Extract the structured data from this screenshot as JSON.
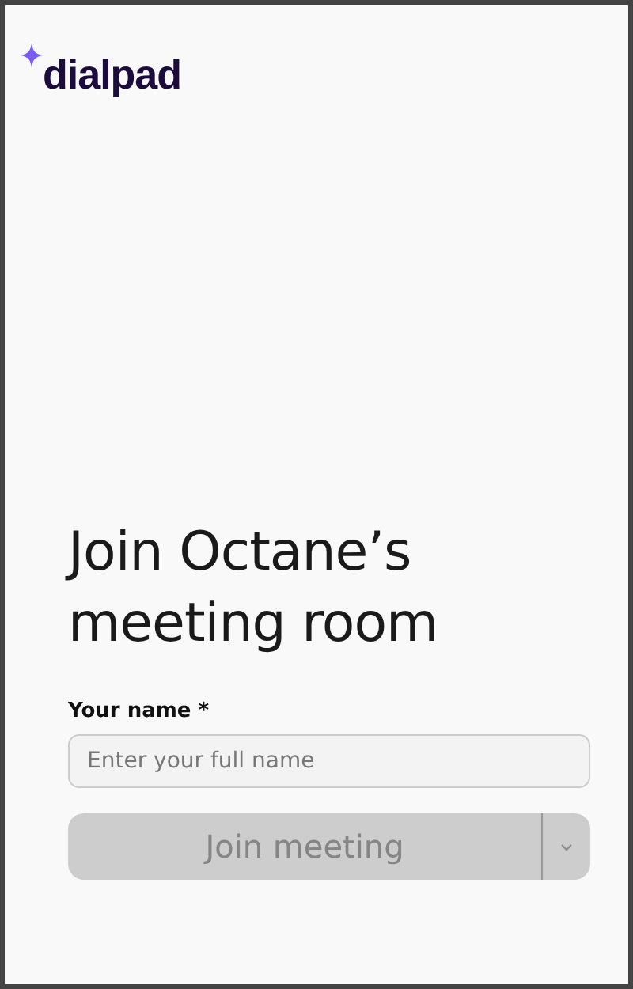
{
  "logo": {
    "text": "dialpad"
  },
  "title": "Join Octane’s meeting room",
  "name_field": {
    "label": "Your name *",
    "placeholder": "Enter your full name"
  },
  "join_button": {
    "label": "Join meeting",
    "disabled": true
  }
}
